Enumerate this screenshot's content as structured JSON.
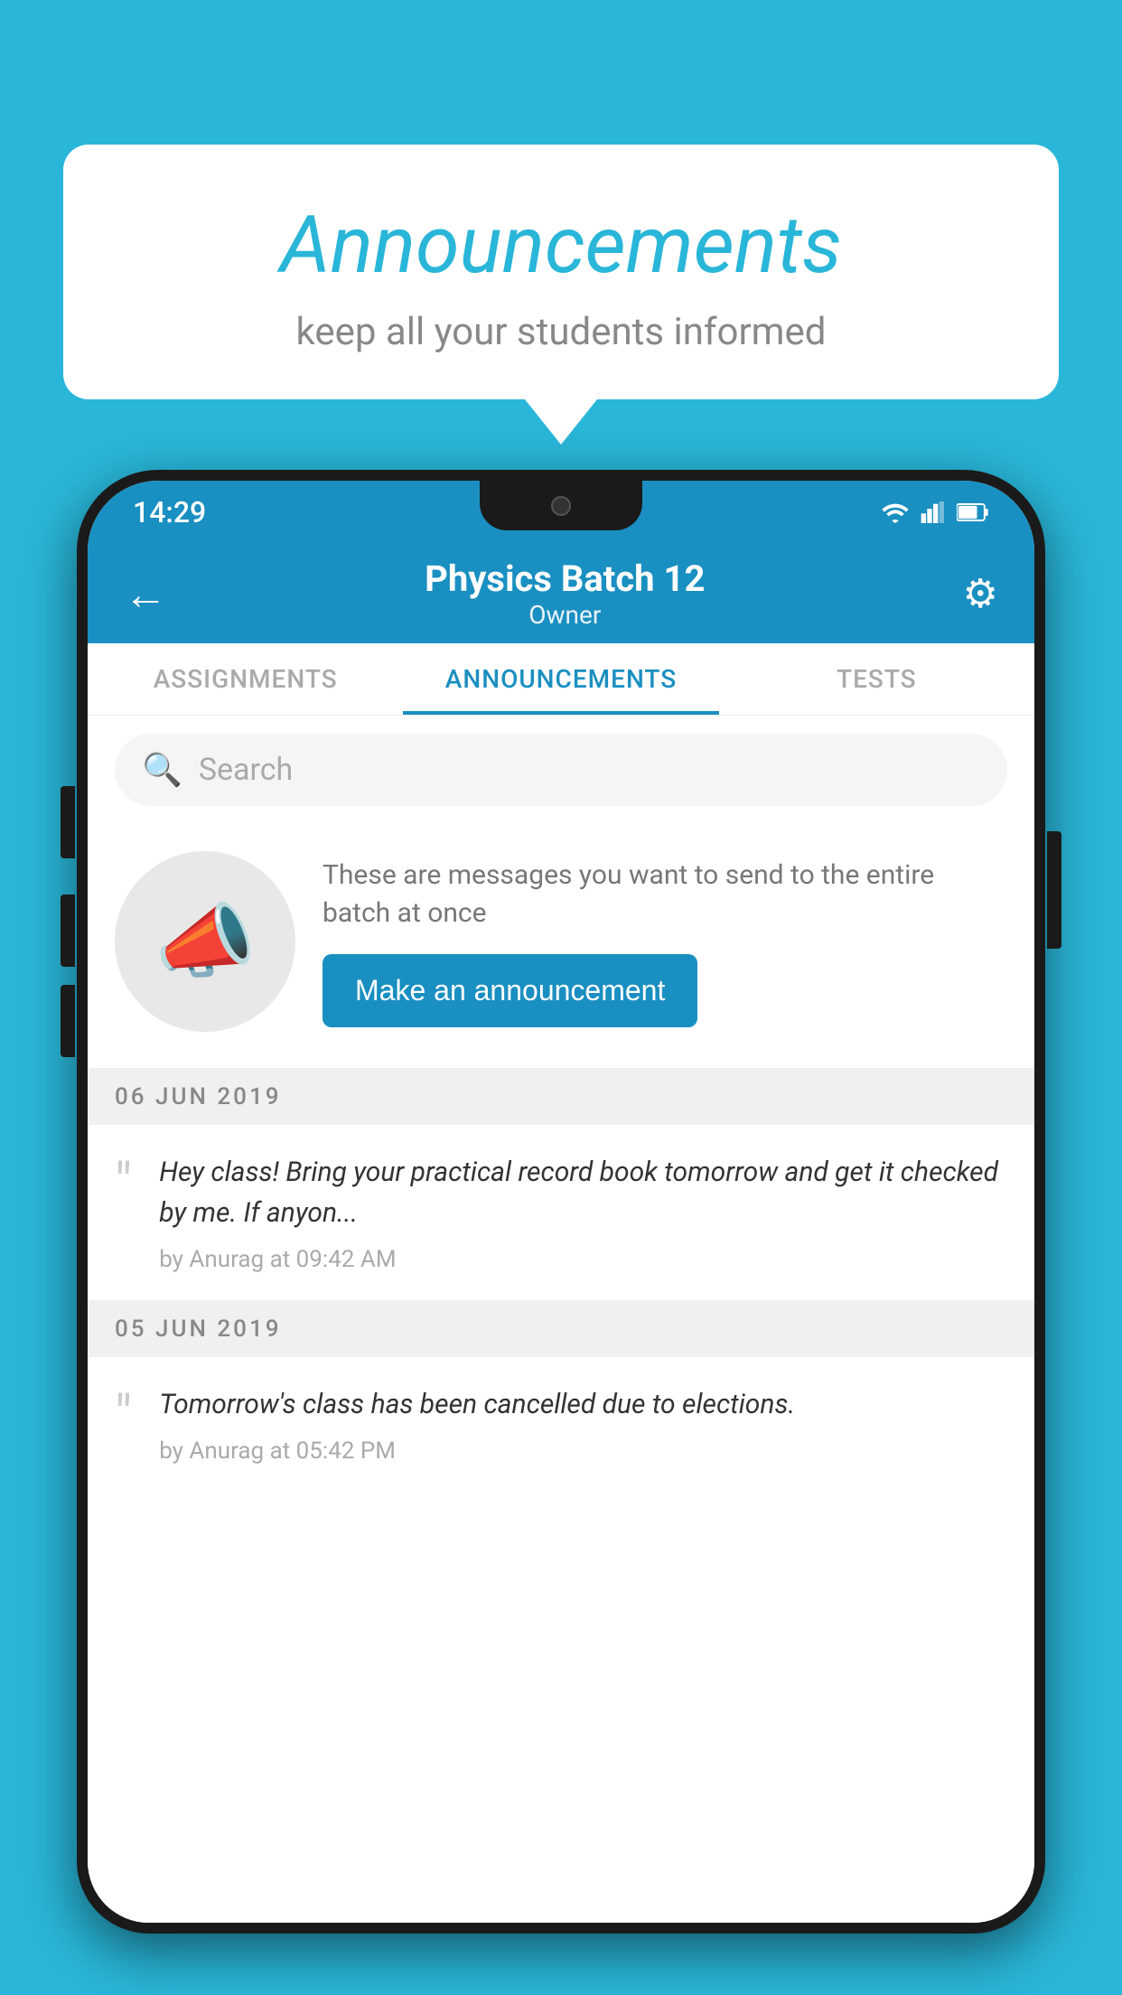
{
  "bubble": {
    "title": "Announcements",
    "subtitle": "keep all your students informed"
  },
  "phone": {
    "status_bar": {
      "time": "14:29"
    },
    "header": {
      "title": "Physics Batch 12",
      "subtitle": "Owner",
      "back_label": "←",
      "settings_label": "⚙"
    },
    "tabs": [
      {
        "label": "ASSIGNMENTS",
        "active": false
      },
      {
        "label": "ANNOUNCEMENTS",
        "active": true
      },
      {
        "label": "TESTS",
        "active": false
      }
    ],
    "search": {
      "placeholder": "Search"
    },
    "announcement_prompt": {
      "description": "These are messages you want to send to the entire batch at once",
      "button_label": "Make an announcement"
    },
    "announcements": [
      {
        "date": "06  JUN  2019",
        "text": "Hey class! Bring your practical record book tomorrow and get it checked by me. If anyon...",
        "meta": "by Anurag at 09:42 AM"
      },
      {
        "date": "05  JUN  2019",
        "text": "Tomorrow's class has been cancelled due to elections.",
        "meta": "by Anurag at 05:42 PM"
      }
    ]
  },
  "colors": {
    "primary": "#1a8fc1",
    "background": "#29b6d8",
    "tab_active": "#1a8fc1",
    "tab_inactive": "#aaa"
  }
}
